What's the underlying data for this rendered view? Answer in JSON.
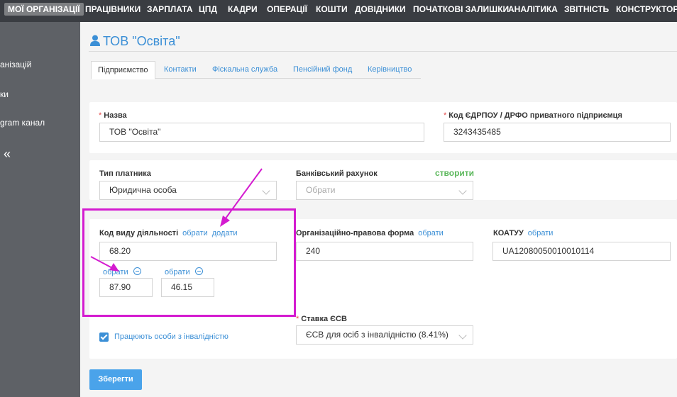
{
  "topnav": {
    "items": [
      "МОЇ ОРГАНІЗАЦІЇ",
      "ПРАЦІВНИКИ",
      "ЗАРПЛАТА",
      "ЦПД",
      "КАДРИ",
      "ОПЕРАЦІЇ",
      "КОШТИ",
      "ДОВІДНИКИ",
      "ПОЧАТКОВІ ЗАЛИШКИ",
      "АНАЛІТИКА",
      "ЗВІТНІСТЬ",
      "КОНСТРУКТОР Г"
    ]
  },
  "sidebar": {
    "items": [
      "анізацій",
      "ки",
      "gram канал"
    ],
    "collapse_icon": "«"
  },
  "page": {
    "title": "ТОВ \"Освіта\""
  },
  "tabs": [
    "Підприємство",
    "Контакти",
    "Фіскальна служба",
    "Пенсійний фонд",
    "Керівництво"
  ],
  "form": {
    "name_label": "Назва",
    "name_value": "ТОВ \"Освіта\"",
    "code_label": "Код ЄДРПОУ / ДРФО приватного підприємця",
    "code_value": "3243435485",
    "payer_type_label": "Тип платника",
    "payer_type_value": "Юридична особа",
    "bank_label": "Банківський рахунок",
    "bank_create": "створити",
    "bank_placeholder": "Обрати",
    "activity_label": "Код виду діяльності",
    "activity_choose": "обрати",
    "activity_add": "додати",
    "activity_main": "68.20",
    "extra_choose_1": "обрати",
    "extra_value_1": "87.90",
    "extra_choose_2": "обрати",
    "extra_value_2": "46.15",
    "org_form_label": "Організаційно-правова форма",
    "org_form_choose": "обрати",
    "org_form_value": "240",
    "koatuu_label": "КОАТУУ",
    "koatuu_choose": "обрати",
    "koatuu_value": "UA12080050010010114",
    "esv_label": "Ставка ЄСВ",
    "esv_value": "ЄСВ для осіб з інвалідністю (8.41%)",
    "disabled_label": "Працюють особи з інвалідністю",
    "save_label": "Зберегти"
  },
  "colors": {
    "accent": "#3b8fd6",
    "highlight": "#d41bd0",
    "nav_bg": "#3a3d42",
    "sidebar_bg": "#5e6166"
  }
}
